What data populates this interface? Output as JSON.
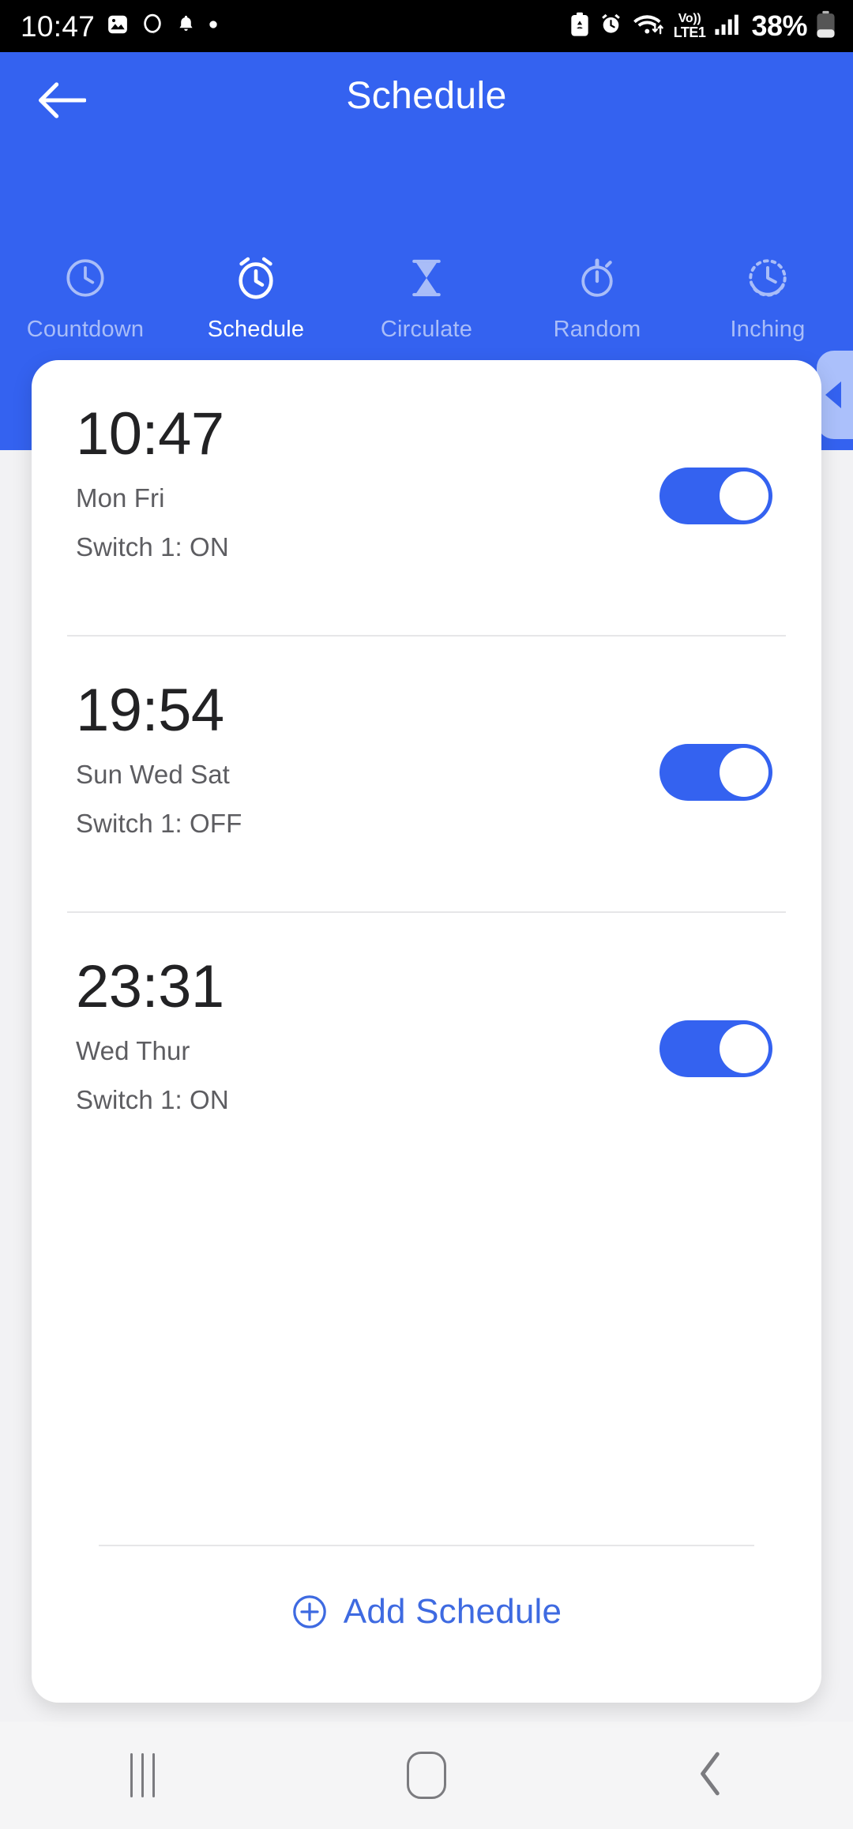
{
  "status_bar": {
    "clock": "10:47",
    "left_icons": [
      "image-icon",
      "circle-icon",
      "bell-icon",
      "dot-icon"
    ],
    "right_icons": [
      "battery-saver-icon",
      "alarm-icon",
      "wifi-data-icon",
      "signal-bars-icon"
    ],
    "network_label_top": "Vo))",
    "network_label_bottom": "LTE1",
    "battery_percent": "38%"
  },
  "header": {
    "back_icon": "arrow-left-icon",
    "title": "Schedule",
    "background_color": "#3462f0"
  },
  "tabs": [
    {
      "label": "Countdown",
      "icon": "clock-icon",
      "active": false
    },
    {
      "label": "Schedule",
      "icon": "alarm-clock-icon",
      "active": true
    },
    {
      "label": "Circulate",
      "icon": "hourglass-icon",
      "active": false
    },
    {
      "label": "Random",
      "icon": "stopwatch-icon",
      "active": false
    },
    {
      "label": "Inching",
      "icon": "dashed-clock-icon",
      "active": false
    }
  ],
  "drawer_handle": {
    "icon": "triangle-left-icon",
    "color": "#abc0fb"
  },
  "schedules": [
    {
      "time": "10:47",
      "days": "Mon Fri",
      "action": "Switch 1: ON",
      "enabled": true
    },
    {
      "time": "19:54",
      "days": "Sun Wed Sat",
      "action": "Switch 1: OFF",
      "enabled": true
    },
    {
      "time": "23:31",
      "days": "Wed Thur",
      "action": "Switch 1: ON",
      "enabled": true
    }
  ],
  "add_schedule": {
    "label": "Add Schedule",
    "icon": "plus-circle-icon",
    "color": "#3e6ae1"
  },
  "nav_bar": {
    "recents": "recents-icon",
    "home": "home-icon",
    "back": "back-icon"
  }
}
